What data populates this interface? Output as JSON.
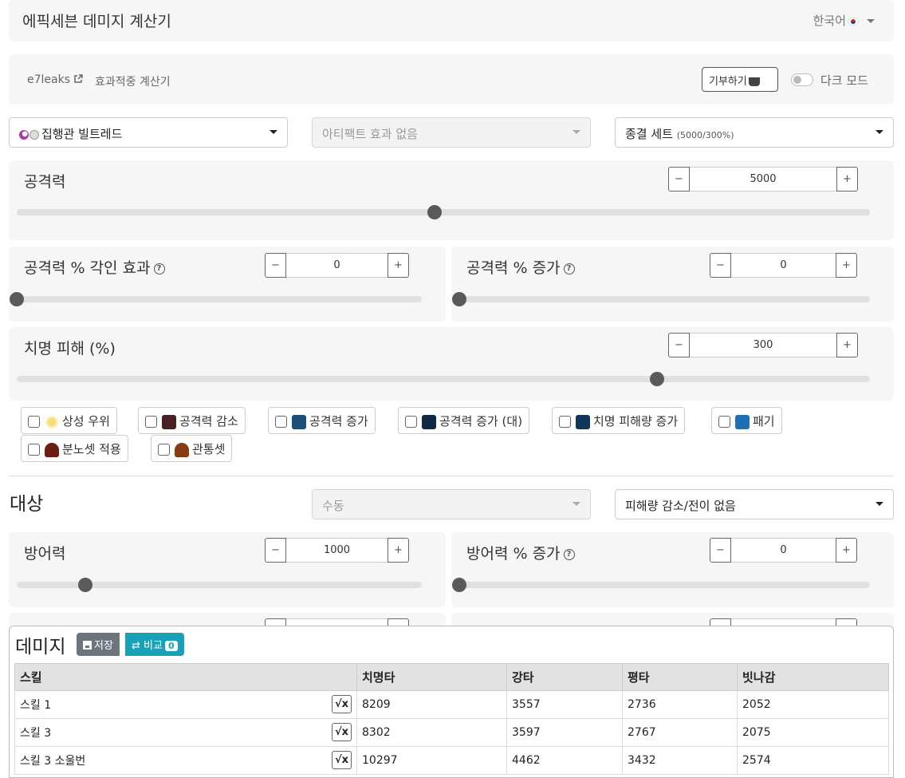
{
  "header": {
    "title": "에픽세븐 데미지 계산기",
    "language": "한국어"
  },
  "links": {
    "e7leaks": "e7leaks",
    "hit_calc": "효과적중 계산기",
    "donate": "기부하기",
    "dark_mode": "다크 모드"
  },
  "selects": {
    "hero": "집행관 빌트레드",
    "artifact_placeholder": "아티팩트 효과 없음",
    "set": "종결 세트",
    "set_detail": "(5000/300%)"
  },
  "stats": {
    "attack": {
      "label": "공격력",
      "value": "5000",
      "slider_fraction": 0.49
    },
    "atk_imprint": {
      "label": "공격력 % 각인 효과",
      "value": "0",
      "slider_fraction": 0.0
    },
    "atk_increase": {
      "label": "공격력 % 증가",
      "value": "0",
      "slider_fraction": 0.0
    },
    "crit_damage": {
      "label": "치명 피해 (%)",
      "value": "300",
      "slider_fraction": 0.75
    }
  },
  "buffs": [
    {
      "label": "상성 우위",
      "icon": "elemental-advantage-icon",
      "color": "#f0c040"
    },
    {
      "label": "공격력 감소",
      "icon": "attack-down-icon",
      "color": "#c0392b"
    },
    {
      "label": "공격력 증가",
      "icon": "attack-up-icon",
      "color": "#2e86c1"
    },
    {
      "label": "공격력 증가 (대)",
      "icon": "greater-attack-up-icon",
      "color": "#1b4f72"
    },
    {
      "label": "치명 피해량 증가",
      "icon": "crit-damage-up-icon",
      "color": "#1f618d"
    },
    {
      "label": "패기",
      "icon": "vigor-icon",
      "color": "#2874a6"
    },
    {
      "label": "분노셋 적용",
      "icon": "rage-set-icon",
      "color": "#7b241c"
    },
    {
      "label": "관통셋",
      "icon": "penetration-set-icon",
      "color": "#a04000"
    }
  ],
  "target": {
    "title": "대상",
    "mode_placeholder": "수동",
    "damage_reduction": "피해량 감소/전이 없음",
    "defense": {
      "label": "방어력",
      "value": "1000",
      "slider_fraction": 0.17
    },
    "def_increase": {
      "label": "방어력 % 증가",
      "value": "0",
      "slider_fraction": 0.0
    }
  },
  "damage": {
    "title": "데미지",
    "save": "저장",
    "compare": "비교",
    "compare_count": "0",
    "columns": [
      "스킬",
      "치명타",
      "강타",
      "평타",
      "빗나감"
    ],
    "rows": [
      {
        "skill": "스킬 1",
        "crit": "8209",
        "crush": "3557",
        "normal": "2736",
        "miss": "2052"
      },
      {
        "skill": "스킬 3",
        "crit": "8302",
        "crush": "3597",
        "normal": "2767",
        "miss": "2075"
      },
      {
        "skill": "스킬 3 소울번",
        "crit": "10297",
        "crush": "4462",
        "normal": "3432",
        "miss": "2574"
      }
    ]
  }
}
